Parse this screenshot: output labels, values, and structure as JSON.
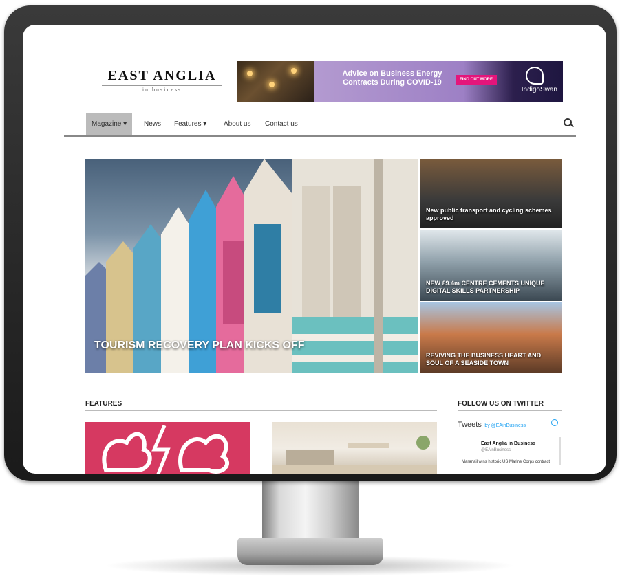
{
  "logo": {
    "main": "EAST ANGLIA",
    "sub": "in business"
  },
  "ad": {
    "headline": "Advice on Business Energy Contracts During COVID-19",
    "cta": "FIND OUT MORE",
    "brand": "IndigoSwan"
  },
  "nav": {
    "items": [
      "Magazine ▾",
      "News",
      "Features ▾",
      "About us",
      "Contact us"
    ]
  },
  "hero": {
    "title": "TOURISM RECOVERY PLAN KICKS OFF"
  },
  "side_stories": [
    {
      "title": "New public transport and cycling schemes approved"
    },
    {
      "title": "NEW £9.4m CENTRE CEMENTS UNIQUE DIGITAL SKILLS PARTNERSHIP"
    },
    {
      "title": "REVIVING THE BUSINESS HEART AND SOUL OF A SEASIDE TOWN"
    }
  ],
  "features": {
    "heading": "FEATURES"
  },
  "twitter": {
    "heading": "FOLLOW US ON TWITTER",
    "widget_title": "Tweets",
    "by": "by @EAinBusiness",
    "account_name": "East Anglia in Business",
    "account_handle": "@EAinBusiness",
    "tweet_text": "Maranail wins historic US Marine Corps contract"
  },
  "colors": {
    "ad_cta": "#e4157b",
    "feature_card": "#d63961",
    "twitter": "#1da1f2"
  }
}
